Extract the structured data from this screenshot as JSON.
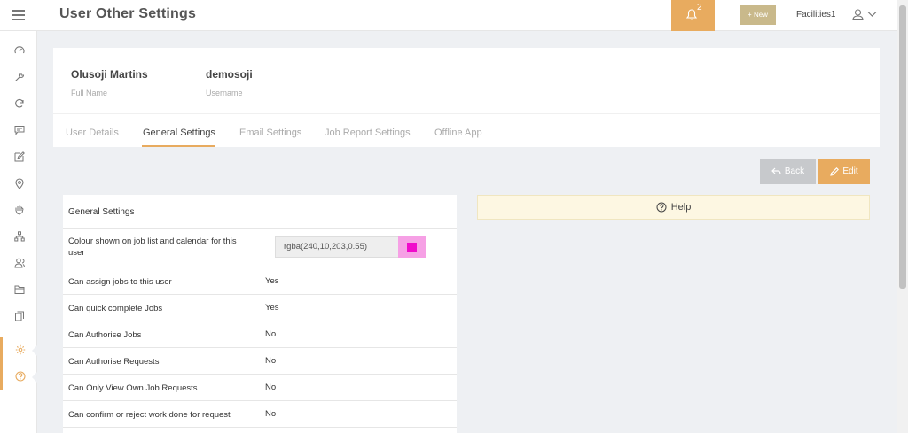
{
  "header": {
    "title": "User Other Settings",
    "notification_count": "2",
    "new_label": "+ New",
    "user_name": "Facilities1"
  },
  "profile": {
    "full_name": "Olusoji Martins",
    "full_name_label": "Full Name",
    "username": "demosoji",
    "username_label": "Username"
  },
  "tabs": [
    {
      "label": "User Details",
      "active": false
    },
    {
      "label": "General Settings",
      "active": true
    },
    {
      "label": "Email Settings",
      "active": false
    },
    {
      "label": "Job Report Settings",
      "active": false
    },
    {
      "label": "Offline App",
      "active": false
    }
  ],
  "actions": {
    "back_label": "Back",
    "edit_label": "Edit"
  },
  "settings": {
    "title": "General Settings",
    "colour": {
      "label": "Colour shown on job list and calendar for this user",
      "value": "rgba(240,10,203,0.55)"
    },
    "rows": [
      {
        "label": "Can assign jobs to this user",
        "value": "Yes"
      },
      {
        "label": "Can quick complete Jobs",
        "value": "Yes"
      },
      {
        "label": "Can Authorise Jobs",
        "value": "No"
      },
      {
        "label": "Can Authorise Requests",
        "value": "No"
      },
      {
        "label": "Can Only View Own Job Requests",
        "value": "No"
      },
      {
        "label": "Can confirm or reject work done for request",
        "value": "No"
      }
    ]
  },
  "help": {
    "label": "Help"
  },
  "sidebar": {
    "items": [
      {
        "icon": "dashboard-icon"
      },
      {
        "icon": "wrench-icon"
      },
      {
        "icon": "refresh-icon"
      },
      {
        "icon": "chat-icon"
      },
      {
        "icon": "edit-icon"
      },
      {
        "icon": "location-pin-icon"
      },
      {
        "icon": "hand-icon"
      },
      {
        "icon": "org-chart-icon"
      },
      {
        "icon": "users-icon"
      },
      {
        "icon": "folder-icon"
      },
      {
        "icon": "documents-icon"
      },
      {
        "icon": "gear-icon",
        "active": true
      },
      {
        "icon": "help-icon"
      }
    ]
  },
  "colors": {
    "accent": "#e8ab5f",
    "swatch": "#f00acb",
    "new_button": "#c9b98b",
    "back_button": "#c7c9cc"
  }
}
